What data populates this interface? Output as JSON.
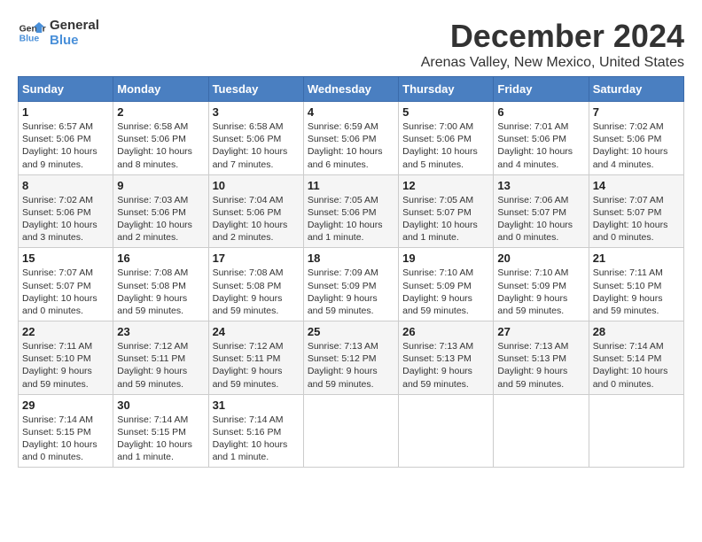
{
  "logo": {
    "line1": "General",
    "line2": "Blue"
  },
  "title": "December 2024",
  "location": "Arenas Valley, New Mexico, United States",
  "days_of_week": [
    "Sunday",
    "Monday",
    "Tuesday",
    "Wednesday",
    "Thursday",
    "Friday",
    "Saturday"
  ],
  "weeks": [
    [
      {
        "day": "1",
        "info": "Sunrise: 6:57 AM\nSunset: 5:06 PM\nDaylight: 10 hours and 9 minutes."
      },
      {
        "day": "2",
        "info": "Sunrise: 6:58 AM\nSunset: 5:06 PM\nDaylight: 10 hours and 8 minutes."
      },
      {
        "day": "3",
        "info": "Sunrise: 6:58 AM\nSunset: 5:06 PM\nDaylight: 10 hours and 7 minutes."
      },
      {
        "day": "4",
        "info": "Sunrise: 6:59 AM\nSunset: 5:06 PM\nDaylight: 10 hours and 6 minutes."
      },
      {
        "day": "5",
        "info": "Sunrise: 7:00 AM\nSunset: 5:06 PM\nDaylight: 10 hours and 5 minutes."
      },
      {
        "day": "6",
        "info": "Sunrise: 7:01 AM\nSunset: 5:06 PM\nDaylight: 10 hours and 4 minutes."
      },
      {
        "day": "7",
        "info": "Sunrise: 7:02 AM\nSunset: 5:06 PM\nDaylight: 10 hours and 4 minutes."
      }
    ],
    [
      {
        "day": "8",
        "info": "Sunrise: 7:02 AM\nSunset: 5:06 PM\nDaylight: 10 hours and 3 minutes."
      },
      {
        "day": "9",
        "info": "Sunrise: 7:03 AM\nSunset: 5:06 PM\nDaylight: 10 hours and 2 minutes."
      },
      {
        "day": "10",
        "info": "Sunrise: 7:04 AM\nSunset: 5:06 PM\nDaylight: 10 hours and 2 minutes."
      },
      {
        "day": "11",
        "info": "Sunrise: 7:05 AM\nSunset: 5:06 PM\nDaylight: 10 hours and 1 minute."
      },
      {
        "day": "12",
        "info": "Sunrise: 7:05 AM\nSunset: 5:07 PM\nDaylight: 10 hours and 1 minute."
      },
      {
        "day": "13",
        "info": "Sunrise: 7:06 AM\nSunset: 5:07 PM\nDaylight: 10 hours and 0 minutes."
      },
      {
        "day": "14",
        "info": "Sunrise: 7:07 AM\nSunset: 5:07 PM\nDaylight: 10 hours and 0 minutes."
      }
    ],
    [
      {
        "day": "15",
        "info": "Sunrise: 7:07 AM\nSunset: 5:07 PM\nDaylight: 10 hours and 0 minutes."
      },
      {
        "day": "16",
        "info": "Sunrise: 7:08 AM\nSunset: 5:08 PM\nDaylight: 9 hours and 59 minutes."
      },
      {
        "day": "17",
        "info": "Sunrise: 7:08 AM\nSunset: 5:08 PM\nDaylight: 9 hours and 59 minutes."
      },
      {
        "day": "18",
        "info": "Sunrise: 7:09 AM\nSunset: 5:09 PM\nDaylight: 9 hours and 59 minutes."
      },
      {
        "day": "19",
        "info": "Sunrise: 7:10 AM\nSunset: 5:09 PM\nDaylight: 9 hours and 59 minutes."
      },
      {
        "day": "20",
        "info": "Sunrise: 7:10 AM\nSunset: 5:09 PM\nDaylight: 9 hours and 59 minutes."
      },
      {
        "day": "21",
        "info": "Sunrise: 7:11 AM\nSunset: 5:10 PM\nDaylight: 9 hours and 59 minutes."
      }
    ],
    [
      {
        "day": "22",
        "info": "Sunrise: 7:11 AM\nSunset: 5:10 PM\nDaylight: 9 hours and 59 minutes."
      },
      {
        "day": "23",
        "info": "Sunrise: 7:12 AM\nSunset: 5:11 PM\nDaylight: 9 hours and 59 minutes."
      },
      {
        "day": "24",
        "info": "Sunrise: 7:12 AM\nSunset: 5:11 PM\nDaylight: 9 hours and 59 minutes."
      },
      {
        "day": "25",
        "info": "Sunrise: 7:13 AM\nSunset: 5:12 PM\nDaylight: 9 hours and 59 minutes."
      },
      {
        "day": "26",
        "info": "Sunrise: 7:13 AM\nSunset: 5:13 PM\nDaylight: 9 hours and 59 minutes."
      },
      {
        "day": "27",
        "info": "Sunrise: 7:13 AM\nSunset: 5:13 PM\nDaylight: 9 hours and 59 minutes."
      },
      {
        "day": "28",
        "info": "Sunrise: 7:14 AM\nSunset: 5:14 PM\nDaylight: 10 hours and 0 minutes."
      }
    ],
    [
      {
        "day": "29",
        "info": "Sunrise: 7:14 AM\nSunset: 5:15 PM\nDaylight: 10 hours and 0 minutes."
      },
      {
        "day": "30",
        "info": "Sunrise: 7:14 AM\nSunset: 5:15 PM\nDaylight: 10 hours and 1 minute."
      },
      {
        "day": "31",
        "info": "Sunrise: 7:14 AM\nSunset: 5:16 PM\nDaylight: 10 hours and 1 minute."
      },
      null,
      null,
      null,
      null
    ]
  ]
}
